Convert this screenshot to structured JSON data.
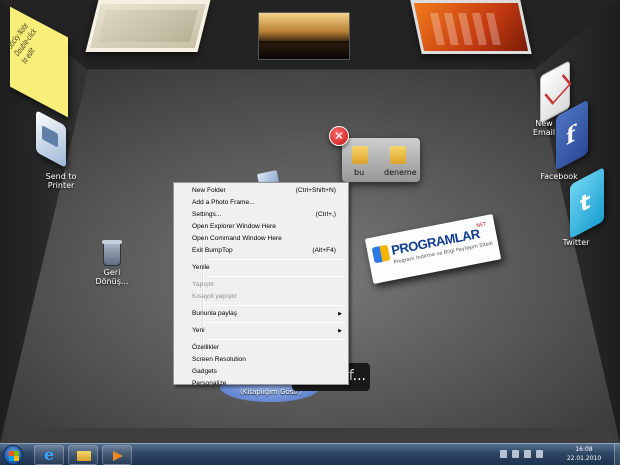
{
  "room": {
    "sticky_note_text": "Sticky Note Double-click to edit",
    "left_wall_icons": [
      {
        "label": "Send to Printer"
      }
    ],
    "right_wall_icons": [
      {
        "label": "New Email"
      },
      {
        "label": "Facebook"
      },
      {
        "label": "Twitter"
      }
    ],
    "recycle_bin_label": "Geri Dönüş...",
    "pile": {
      "items": [
        "bu",
        "deneme"
      ]
    },
    "banner": {
      "title": "PROGRAMLAR",
      "sup": "NET",
      "subtitle": "Program Indirme ve Bilgi Paylaşım Sitesi"
    },
    "disc_label": "(Kitaplığım Göstr)",
    "search_text": "f..."
  },
  "context_menu": {
    "items": [
      {
        "label": "New Folder",
        "shortcut": "(Ctrl+Shift+N)"
      },
      {
        "label": "Add a Photo Frame..."
      },
      {
        "label": "Settings...",
        "shortcut": "(Ctrl+,)"
      },
      {
        "label": "Open Explorer Window Here"
      },
      {
        "label": "Open Command Window Here"
      },
      {
        "label": "Exit BumpTop",
        "shortcut": "(Alt+F4)"
      },
      {
        "label": "Yenile"
      },
      {
        "label": "Yapıştır"
      },
      {
        "label": "Kısayol yapıştır"
      },
      {
        "label": "Bununla paylaş"
      },
      {
        "label": "Yeni"
      },
      {
        "label": "Özellikler"
      },
      {
        "label": "Screen Resolution"
      },
      {
        "label": "Gadgets"
      },
      {
        "label": "Personalize"
      }
    ]
  },
  "taskbar": {
    "time": "16:08",
    "date": "22.01.2010"
  },
  "colors": {
    "menu_bg": "#f0f0f0",
    "taskbar": "#2e4664",
    "floor": "#5a5a5a"
  }
}
